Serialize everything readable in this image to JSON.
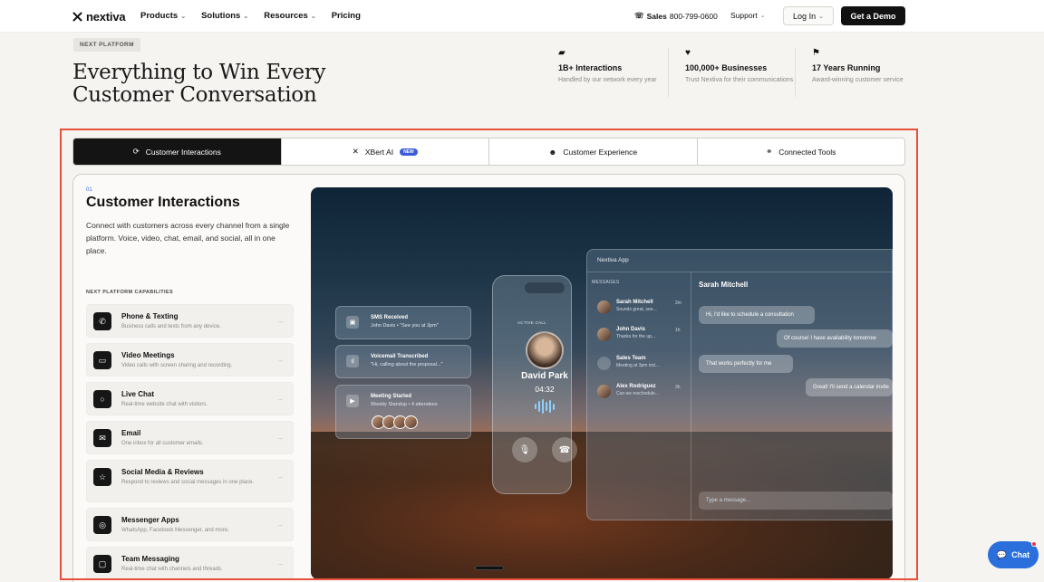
{
  "nav": {
    "logo": "nextiva",
    "menu": [
      "Products",
      "Solutions",
      "Resources",
      "Pricing"
    ],
    "sales_label": "Sales",
    "sales_number": "800-799-0600",
    "support": "Support",
    "login": "Log In",
    "demo": "Get a Demo"
  },
  "hero": {
    "badge": "NEXT PLATFORM",
    "headline_line1": "Everything to Win Every",
    "headline_line2": "Customer Conversation",
    "stats": [
      {
        "title": "1B+ Interactions",
        "desc": "Handled by our network every year",
        "icon": "chat-icon"
      },
      {
        "title": "100,000+ Businesses",
        "desc": "Trust Nextiva for their communications",
        "icon": "heart-icon"
      },
      {
        "title": "17 Years Running",
        "desc": "Award-winning customer service",
        "icon": "flag-icon"
      }
    ]
  },
  "tabs": [
    {
      "label": "Customer Interactions",
      "icon": "chat-refresh-icon"
    },
    {
      "label": "XBert AI",
      "icon": "sparkle-icon",
      "badge": "NEW"
    },
    {
      "label": "Customer Experience",
      "icon": "smile-icon"
    },
    {
      "label": "Connected Tools",
      "icon": "link-icon"
    }
  ],
  "panel": {
    "step": "01",
    "title": "Customer Interactions",
    "desc": "Connect with customers across every channel from a single platform. Voice, video, chat, email, and social, all in one place.",
    "caps_label": "NEXT PLATFORM CAPABILITIES",
    "capabilities": [
      {
        "title": "Phone & Texting",
        "desc": "Business calls and texts from any device."
      },
      {
        "title": "Video Meetings",
        "desc": "Video calls with screen sharing and recording."
      },
      {
        "title": "Live Chat",
        "desc": "Real-time website chat with visitors."
      },
      {
        "title": "Email",
        "desc": "One inbox for all customer emails."
      },
      {
        "title": "Social Media & Reviews",
        "desc": "Respond to reviews and social messages in one place."
      },
      {
        "title": "Messenger Apps",
        "desc": "WhatsApp, Facebook Messenger, and more."
      },
      {
        "title": "Team Messaging",
        "desc": "Real-time chat with channels and threads."
      }
    ]
  },
  "scene": {
    "notifications": [
      {
        "title": "SMS Received",
        "sub": "John Davis • \"See you at 3pm\""
      },
      {
        "title": "Voicemail Transcribed",
        "sub": "\"Hi, calling about the proposal...\""
      },
      {
        "title": "Meeting Started",
        "sub": "Weekly Standup • 4 attendees"
      }
    ],
    "phone": {
      "status": "ACTIVE CALL",
      "caller": "David Park",
      "timer": "04:32"
    },
    "app": {
      "title": "Nextiva App",
      "messages_label": "MESSAGES",
      "conversations": [
        {
          "name": "Sarah Mitchell",
          "preview": "Sounds great, see...",
          "time": "2m"
        },
        {
          "name": "John Davis",
          "preview": "Thanks for the up...",
          "time": "1h"
        },
        {
          "name": "Sales Team",
          "preview": "Meeting at 3pm tod...",
          "time": ""
        },
        {
          "name": "Alex Rodriguez",
          "preview": "Can we reschedule...",
          "time": "3h"
        }
      ],
      "chat_name": "Sarah Mitchell",
      "bubbles": [
        "Hi, I'd like to schedule a consultation",
        "Of course! I have availability tomorrow",
        "That works perfectly for me",
        "Great! I'll send a calendar invite"
      ],
      "placeholder": "Type a message..."
    }
  },
  "fab": {
    "label": "Chat"
  },
  "colors": {
    "accent": "#2a6fdc",
    "highlight": "#e8503a",
    "badge_new": "#3a5cd8"
  }
}
